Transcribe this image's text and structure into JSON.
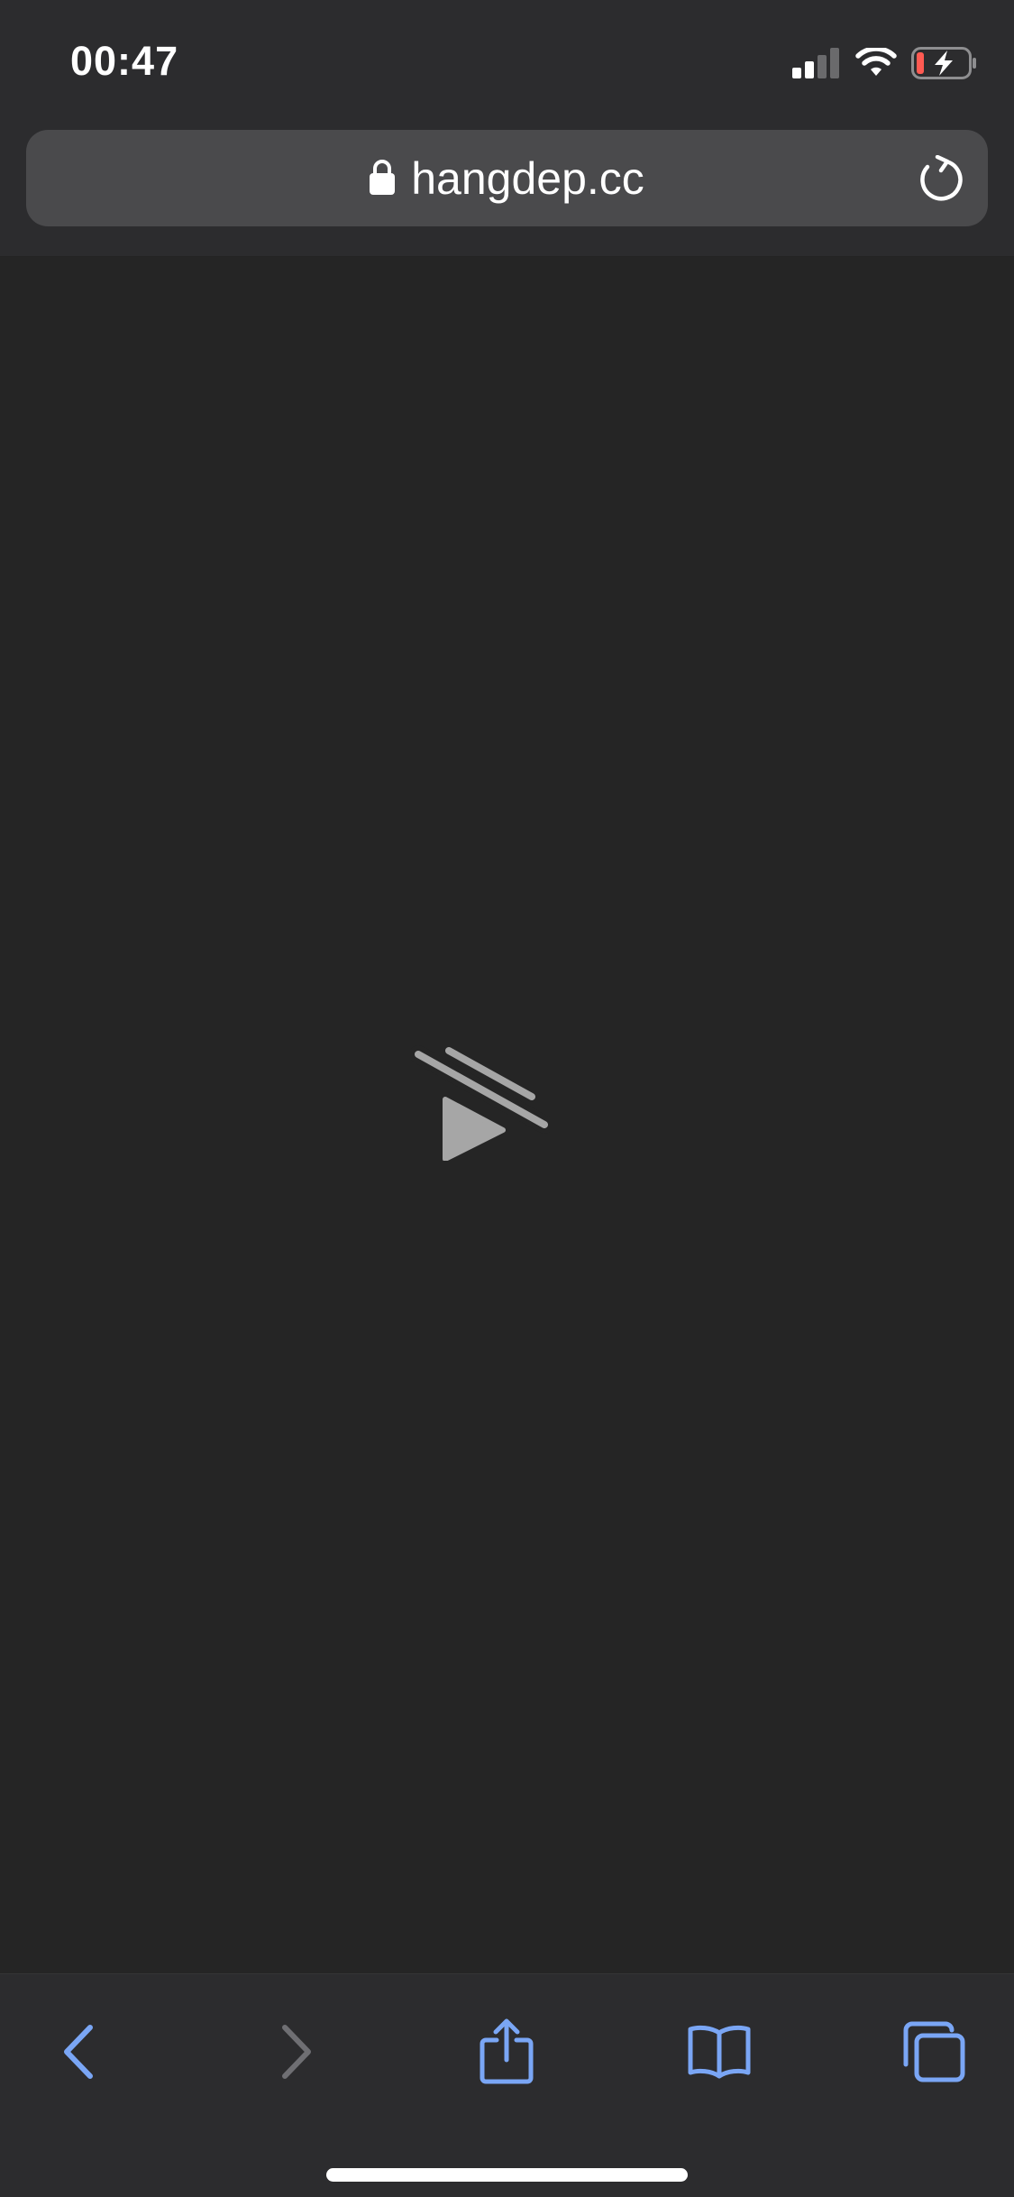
{
  "status_bar": {
    "time": "00:47",
    "icons": [
      "cellular-signal-icon",
      "wifi-icon",
      "battery-charging-icon"
    ]
  },
  "address_bar": {
    "url": "hangdep.cc",
    "icons": [
      "lock-icon",
      "reload-icon"
    ]
  },
  "content": {
    "icon": "video-playback-blocked-icon"
  },
  "toolbar": {
    "items": [
      "back-icon",
      "forward-icon",
      "share-icon",
      "bookmarks-icon",
      "tabs-icon"
    ]
  },
  "colors": {
    "chrome_background": "#2c2c2e",
    "page_background": "#252525",
    "address_field": "#4a4a4c",
    "accent_blue": "#7aa6f5",
    "disabled_gray": "#6f6f73",
    "placeholder_gray": "#a6a6a6",
    "battery_low_red": "#ff5a52"
  }
}
